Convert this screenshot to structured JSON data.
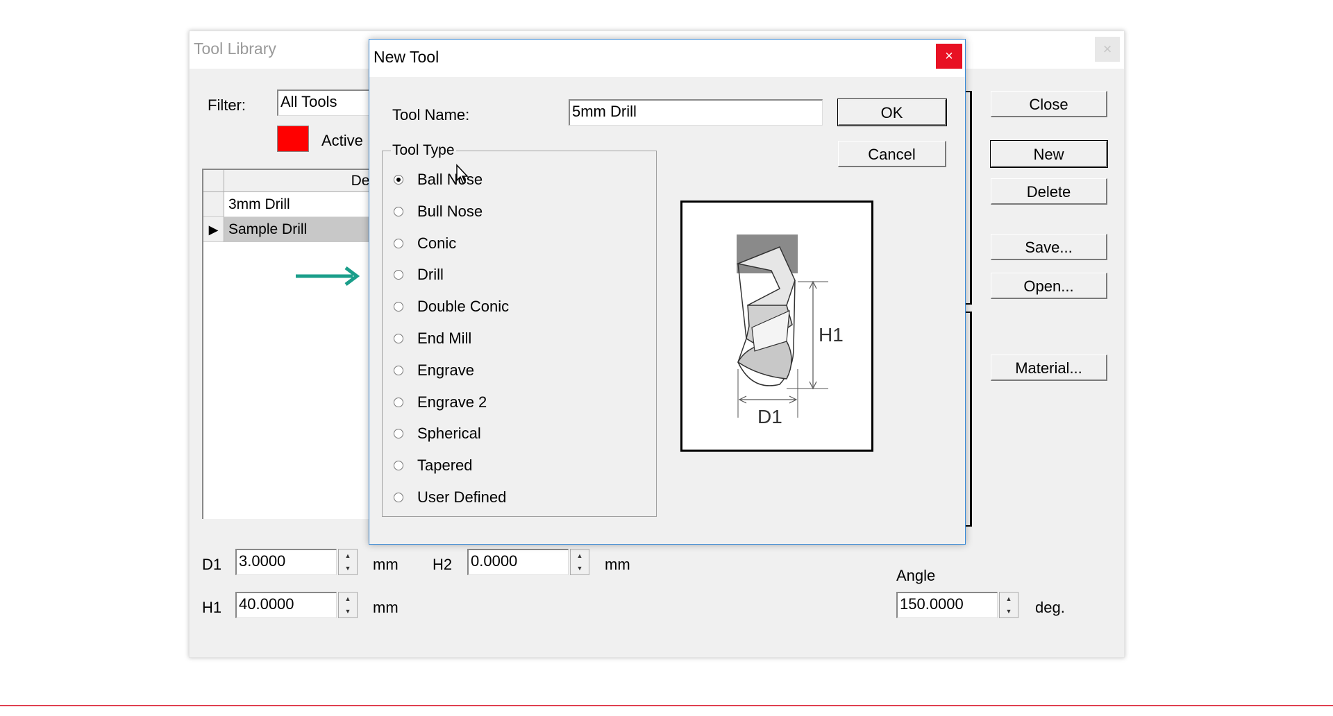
{
  "library": {
    "title": "Tool Library",
    "close_icon": "×",
    "filter_label": "Filter:",
    "filter_value": "All Tools",
    "active_label": "Active",
    "active_color": "#ff0000",
    "table_header": "Des",
    "rows": [
      "3mm Drill",
      "Sample Drill"
    ],
    "selected_row": 1,
    "row_marker": "▶",
    "buttons": {
      "close": "Close",
      "new": "New",
      "delete": "Delete",
      "save": "Save...",
      "open": "Open...",
      "material": "Material..."
    },
    "d1_label": "D1",
    "d1_value": "3.0000",
    "h1_label": "H1",
    "h1_value": "40.0000",
    "h2_label": "H2",
    "h2_value": "0.0000",
    "unit_mm": "mm",
    "angle_label": "Angle",
    "angle_value": "150.0000",
    "unit_deg": "deg."
  },
  "dialog": {
    "title": "New Tool",
    "close_icon": "×",
    "tool_name_label": "Tool Name:",
    "tool_name_value": "5mm Drill",
    "ok": "OK",
    "cancel": "Cancel",
    "tool_type_label": "Tool Type",
    "tool_types": [
      "Ball Nose",
      "Bull Nose",
      "Conic",
      "Drill",
      "Double Conic",
      "End Mill",
      "Engrave",
      "Engrave 2",
      "Spherical",
      "Tapered",
      "User Defined"
    ],
    "selected_type": 0,
    "diagram_labels": {
      "height": "H1",
      "diameter": "D1"
    }
  },
  "annotation": {
    "arrow_color": "#1a9e8a",
    "points_to": "Drill"
  },
  "colors": {
    "window_bg": "#f0f0f0",
    "close_red": "#e81123",
    "accent_line": "#e04050"
  }
}
